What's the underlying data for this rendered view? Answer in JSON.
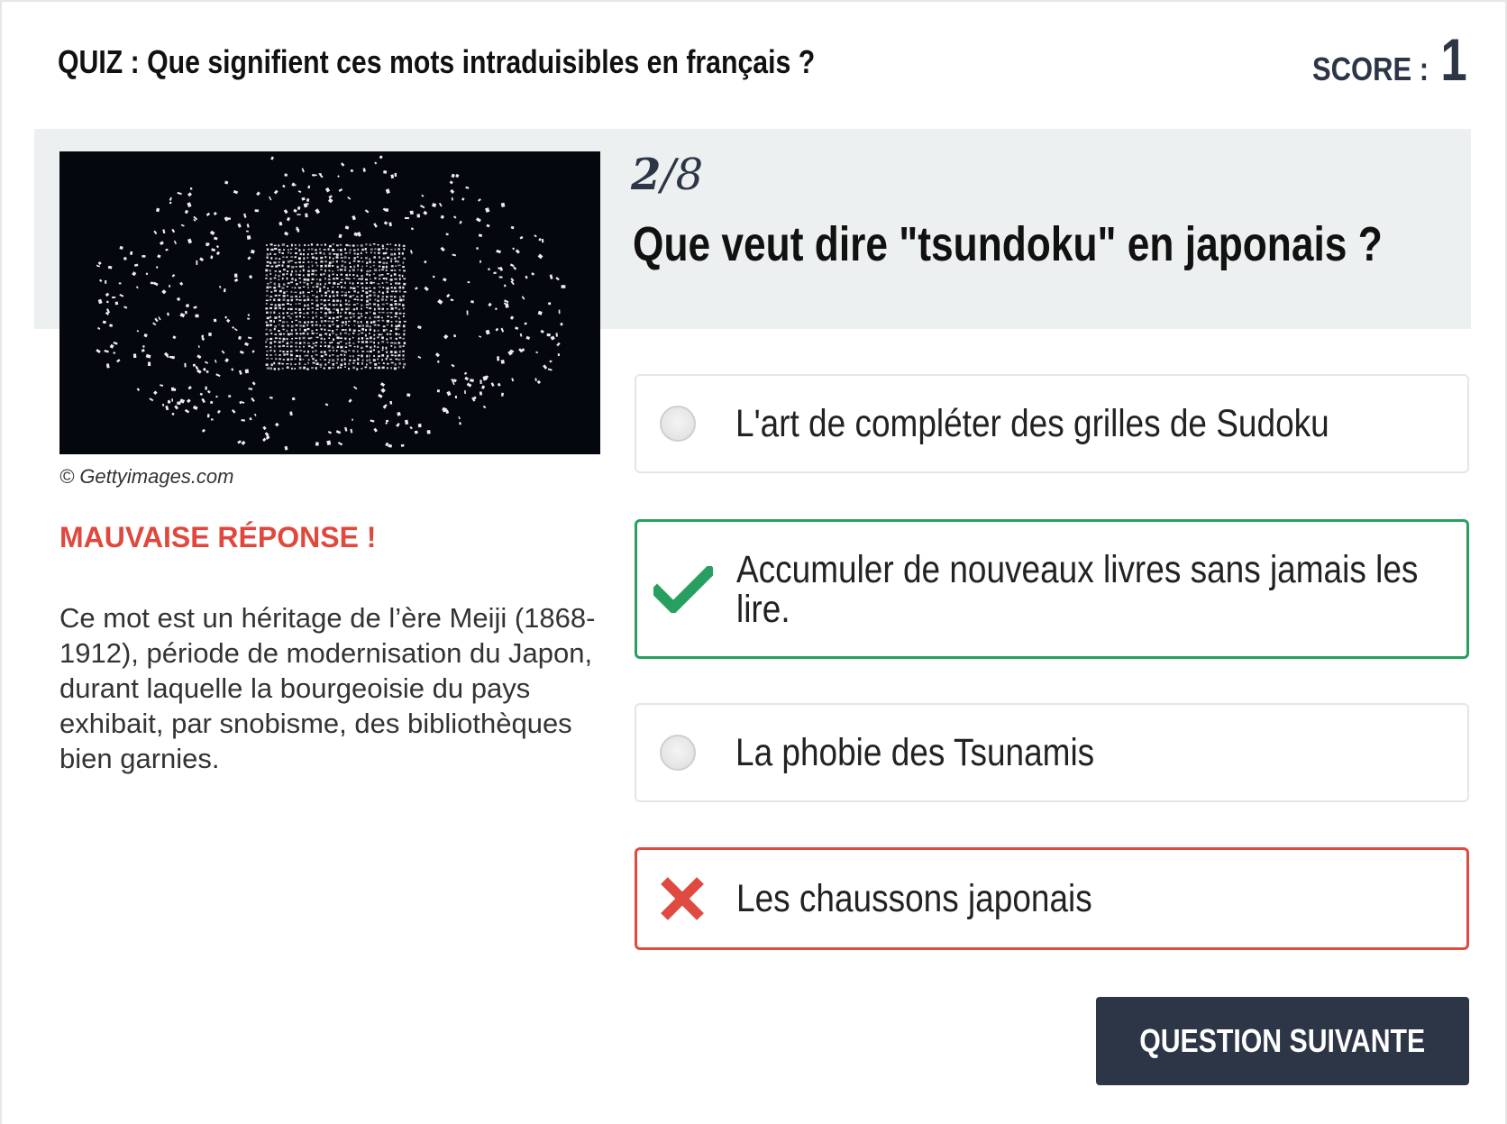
{
  "header": {
    "quiz_title": "QUIZ : Que signifient ces mots intraduisibles en français ?",
    "score_label": "SCORE :",
    "score_value": "1"
  },
  "question": {
    "current": "2",
    "total": "/8",
    "text": "Que veut dire \"tsundoku\" en japonais ?"
  },
  "image": {
    "credit": "© Gettyimages.com"
  },
  "feedback": {
    "result": "MAUVAISE RÉPONSE !",
    "explanation": "Ce mot est un héritage de l’ère Meiji (1868-1912), période de modernisation du Japon, durant laquelle la bourgeoisie du pays exhibait, par snobisme, des bibliothèques bien garnies."
  },
  "answers": [
    {
      "label": "L'art de compléter des grilles de Sudoku",
      "state": "neutral"
    },
    {
      "label": "Accumuler de nouveaux livres sans jamais les lire.",
      "state": "correct"
    },
    {
      "label": "La phobie des Tsunamis",
      "state": "neutral"
    },
    {
      "label": "Les chaussons japonais",
      "state": "wrong"
    }
  ],
  "next_button": {
    "label": "QUESTION SUIVANTE"
  },
  "colors": {
    "accent": "#2c3646",
    "correct": "#27a05f",
    "wrong": "#df4b40",
    "band": "#edf0f1"
  }
}
